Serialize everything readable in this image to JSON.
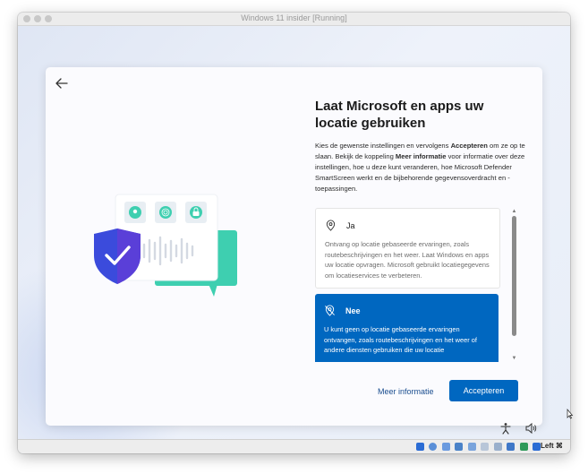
{
  "window": {
    "title": "Windows 11 insider [Running]"
  },
  "oobe": {
    "title": "Laat Microsoft en apps uw locatie gebruiken",
    "description": {
      "p1": "Kies de gewenste instellingen en vervolgens ",
      "accept_word": "Accepteren",
      "p2": " om ze op te slaan. Bekijk de koppeling ",
      "more_word": "Meer informatie",
      "p3": " voor informatie over deze instellingen, hoe u deze kunt veranderen, hoe Microsoft Defender SmartScreen werkt en de bijbehorende gegevensoverdracht en -toepassingen."
    },
    "options": [
      {
        "label": "Ja",
        "icon": "location-pin-icon",
        "description": "Ontvang op locatie gebaseerde ervaringen, zoals routebeschrijvingen en het weer. Laat Windows en apps uw locatie opvragen. Microsoft gebruikt locatiegegevens om locatieservices te verbeteren.",
        "selected": false
      },
      {
        "label": "Nee",
        "icon": "location-off-icon",
        "description": "U kunt geen op locatie gebaseerde ervaringen ontvangen, zoals routebeschrijvingen en het weer of andere diensten gebruiken die uw locatie",
        "selected": true
      }
    ],
    "more_info_link": "Meer informatie",
    "accept_button": "Accepteren"
  },
  "statusbar": {
    "host_key": "Left ⌘"
  },
  "colors": {
    "accent": "#0067c0",
    "shield": "#3b4bdc",
    "chat_bubble": "#3ecfb0"
  }
}
